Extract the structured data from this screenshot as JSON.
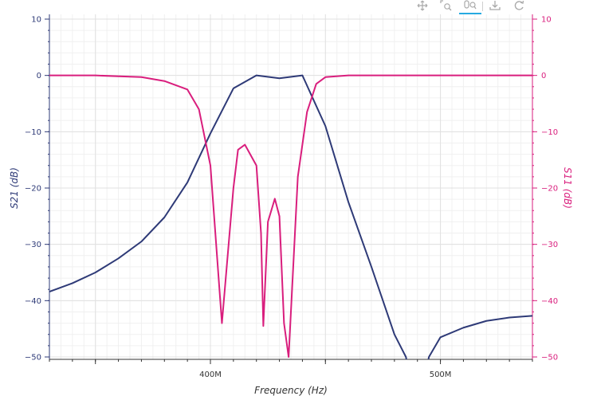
{
  "toolbar": {
    "tools": [
      {
        "name": "pan-tool",
        "icon": "move-icon",
        "active": false
      },
      {
        "name": "box-zoom-tool",
        "icon": "zoom-icon",
        "active": false
      },
      {
        "name": "wheel-zoom-tool",
        "icon": "wheel-zoom-icon",
        "active": true
      },
      {
        "name": "save-tool",
        "icon": "save-icon",
        "active": false
      },
      {
        "name": "reset-tool",
        "icon": "reset-icon",
        "active": false
      }
    ]
  },
  "chart_data": {
    "type": "line",
    "xlabel": "Frequency (Hz)",
    "ylabel_left": "S21 (dB)",
    "ylabel_right": "S11 (dB)",
    "xlim": [
      330000000,
      540000000
    ],
    "ylim_left": [
      -50,
      10
    ],
    "ylim_right": [
      -50,
      10
    ],
    "x_tick_labels": [
      {
        "value": 400000000,
        "label": "400M"
      },
      {
        "value": 500000000,
        "label": "500M"
      }
    ],
    "x_ticks_unlabeled": [
      300000000,
      350000000,
      450000000
    ],
    "y_ticks_left": [
      10,
      0,
      -10,
      -20,
      -30,
      -40,
      -50
    ],
    "y_ticks_right": [
      10,
      0,
      -10,
      -20,
      -30,
      -40,
      -50
    ],
    "grid": true,
    "colors": {
      "s21": "#2e3a77",
      "s11": "#d91e7d"
    },
    "series": [
      {
        "name": "S21",
        "axis": "left",
        "color": "#2e3a77",
        "x": [
          330000000,
          340000000,
          350000000,
          360000000,
          370000000,
          380000000,
          390000000,
          400000000,
          410000000,
          420000000,
          430000000,
          440000000,
          450000000,
          460000000,
          470000000,
          475000000,
          480000000,
          485000000,
          490000000,
          495000000,
          500000000,
          510000000,
          520000000,
          530000000,
          540000000
        ],
        "y": [
          -38.4,
          -36.9,
          -35.0,
          -32.5,
          -29.5,
          -25.2,
          -19.0,
          -10.3,
          -2.3,
          0.0,
          -0.5,
          0.0,
          -9.0,
          -22.5,
          -34.0,
          -40.0,
          -46.0,
          -50.0,
          -60.0,
          -50.0,
          -46.5,
          -44.8,
          -43.6,
          -43.0,
          -42.7
        ]
      },
      {
        "name": "S11",
        "axis": "right",
        "color": "#d91e7d",
        "x": [
          330000000,
          350000000,
          370000000,
          380000000,
          390000000,
          395000000,
          400000000,
          405000000,
          410000000,
          412000000,
          415000000,
          420000000,
          422000000,
          423000000,
          425000000,
          428000000,
          430000000,
          432000000,
          434000000,
          438000000,
          442000000,
          446000000,
          450000000,
          460000000,
          480000000,
          500000000,
          540000000
        ],
        "y": [
          0,
          0,
          -0.3,
          -1.0,
          -2.5,
          -6.0,
          -16.0,
          -44.0,
          -20.0,
          -13.2,
          -12.3,
          -16.0,
          -28.0,
          -44.5,
          -26.0,
          -21.9,
          -25.0,
          -44.0,
          -50.0,
          -18.0,
          -6.5,
          -1.5,
          -0.3,
          0.0,
          0.0,
          0.0,
          0.0
        ]
      }
    ]
  }
}
